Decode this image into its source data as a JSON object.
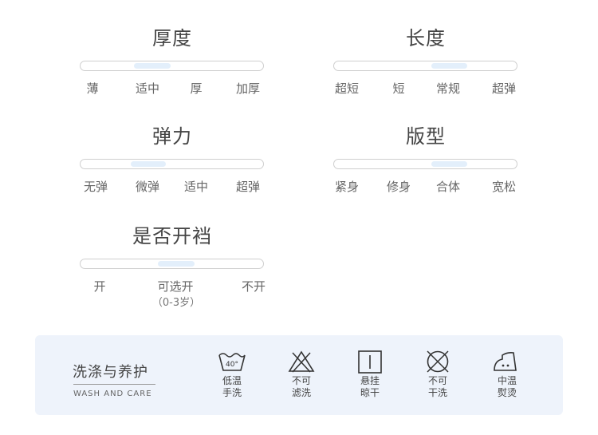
{
  "attributes": {
    "thickness": {
      "title": "厚度",
      "options": [
        "薄",
        "适中",
        "厚",
        "加厚"
      ],
      "selected": "适中"
    },
    "length": {
      "title": "长度",
      "options": [
        "超短",
        "短",
        "常规",
        "超弹"
      ],
      "selected": "常规"
    },
    "elasticity": {
      "title": "弹力",
      "options": [
        "无弹",
        "微弹",
        "适中",
        "超弹"
      ],
      "selected": "微弹"
    },
    "fit": {
      "title": "版型",
      "options": [
        "紧身",
        "修身",
        "合体",
        "宽松"
      ],
      "selected": "合体"
    },
    "crotch_opening": {
      "title": "是否开裆",
      "options": [
        "开",
        "可选开",
        "不开"
      ],
      "option_note": "（0-3岁）",
      "selected": "可选开"
    }
  },
  "care": {
    "title": "洗涤与养护",
    "subtitle": "WASH AND CARE",
    "items": [
      {
        "icon": "wash-40-icon",
        "icon_text": "40°",
        "line1": "低温",
        "line2": "手洗"
      },
      {
        "icon": "no-bleach-icon",
        "line1": "不可",
        "line2": "滤洗"
      },
      {
        "icon": "hang-dry-icon",
        "line1": "悬挂",
        "line2": "晾干"
      },
      {
        "icon": "no-dry-clean-icon",
        "line1": "不可",
        "line2": "干洗"
      },
      {
        "icon": "iron-medium-icon",
        "line1": "中温",
        "line2": "熨烫"
      }
    ]
  },
  "colors": {
    "highlight": "#e3effb",
    "track_border": "#cfcfcf",
    "care_background": "#eef3fb"
  }
}
